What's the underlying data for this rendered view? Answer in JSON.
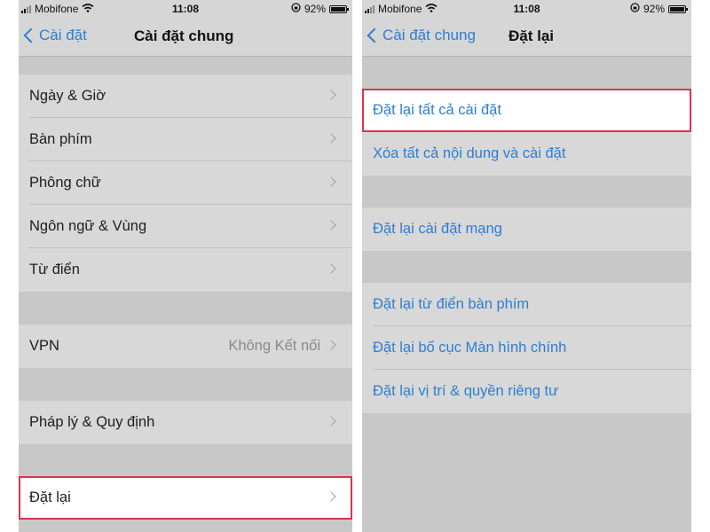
{
  "status_bar": {
    "carrier": "Mobifone",
    "time": "11:08",
    "battery_percent": "92%",
    "battery_level": 0.92
  },
  "left_screen": {
    "back_label": "Cài đặt",
    "title": "Cài đặt chung",
    "items": [
      {
        "label": "Ngày & Giờ"
      },
      {
        "label": "Bàn phím"
      },
      {
        "label": "Phông chữ"
      },
      {
        "label": "Ngôn ngữ & Vùng"
      },
      {
        "label": "Từ điển"
      },
      {
        "label": "VPN",
        "value": "Không Kết nối"
      },
      {
        "label": "Pháp lý & Quy định"
      },
      {
        "label": "Đặt lại",
        "highlighted": true
      }
    ]
  },
  "right_screen": {
    "back_label": "Cài đặt chung",
    "title": "Đặt lại",
    "items": [
      {
        "label": "Đặt lại tất cả cài đặt",
        "highlighted": true
      },
      {
        "label": "Xóa tất cả nội dung và cài đặt"
      },
      {
        "label": "Đặt lại cài đặt mạng"
      },
      {
        "label": "Đặt lại từ điển bàn phím"
      },
      {
        "label": "Đặt lại bố cục Màn hình chính"
      },
      {
        "label": "Đặt lại vị trí & quyền riêng tư"
      }
    ]
  },
  "colors": {
    "link_blue": "#2e7fd0",
    "highlight_border": "#d9344f"
  }
}
